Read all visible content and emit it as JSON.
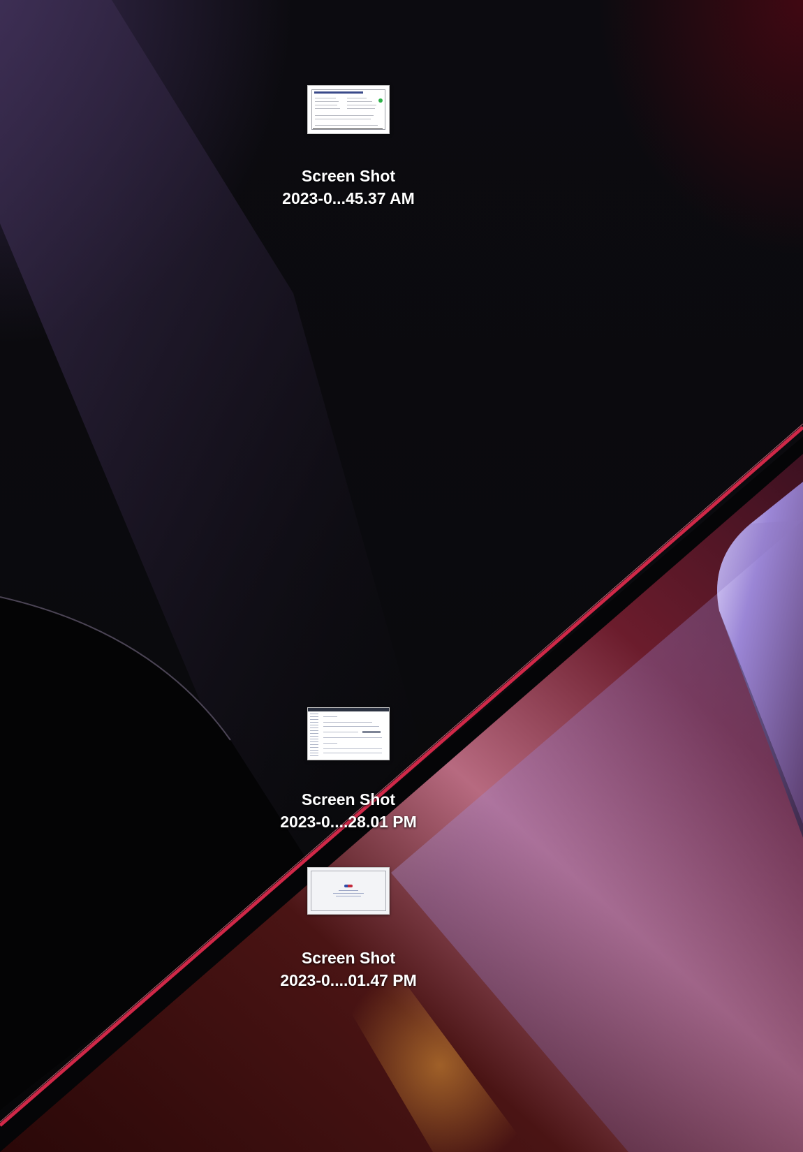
{
  "desktop": {
    "icons": [
      {
        "label_line1": "Screen Shot",
        "label_line2": "2023-0...45.37 AM"
      },
      {
        "label_line1": "Screen Shot",
        "label_line2": "2023-0....28.01 PM"
      },
      {
        "label_line1": "Screen Shot",
        "label_line2": "2023-0....01.47 PM"
      }
    ]
  }
}
